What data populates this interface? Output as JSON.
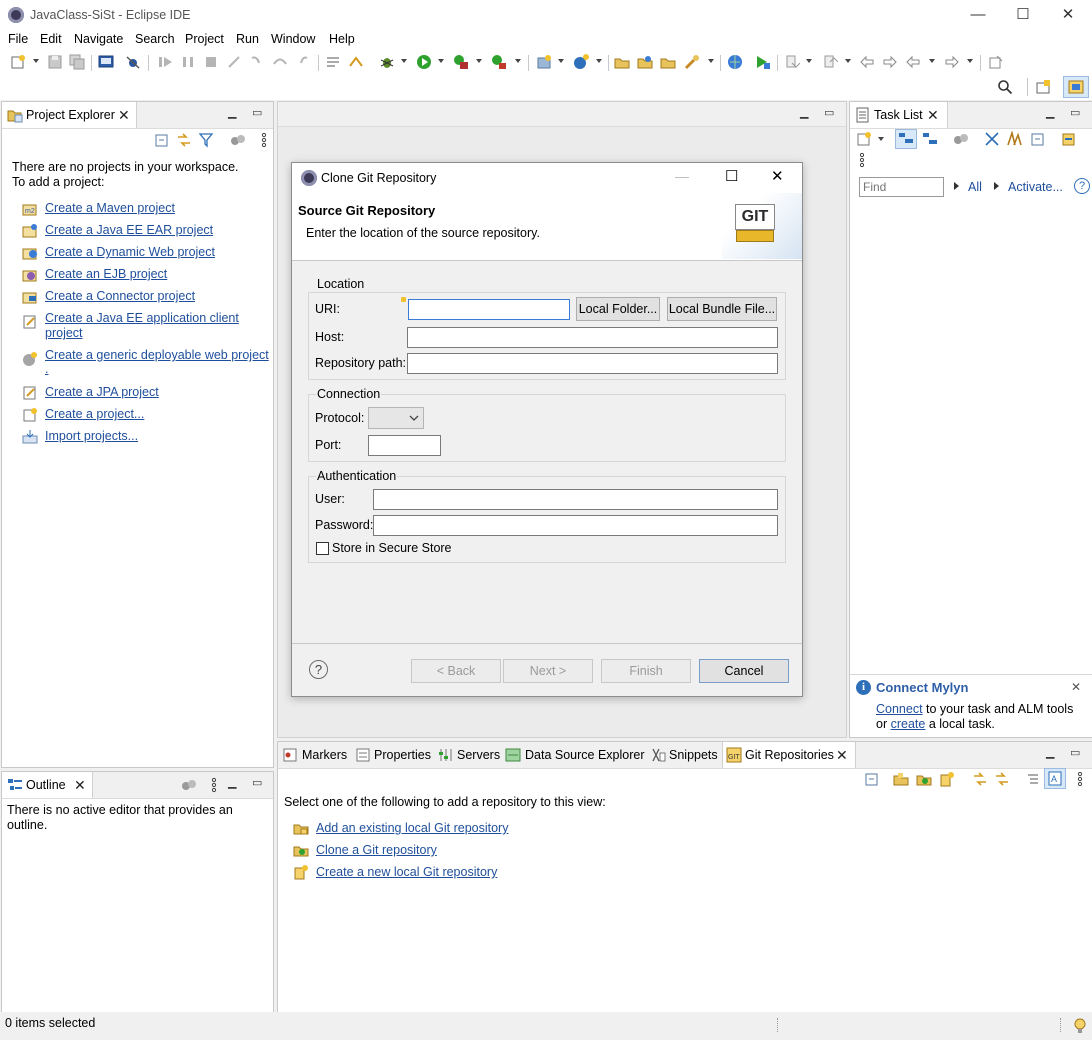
{
  "window": {
    "title": "JavaClass-SiSt - Eclipse IDE"
  },
  "menu": [
    "File",
    "Edit",
    "Navigate",
    "Search",
    "Project",
    "Run",
    "Window",
    "Help"
  ],
  "project_explorer": {
    "tab_label": "Project Explorer",
    "intro_line1": "There are no projects in your workspace.",
    "intro_line2": "To add a project:",
    "links": [
      "Create a Maven project",
      "Create a Java EE EAR project",
      "Create a Dynamic Web project",
      "Create an EJB project",
      "Create a Connector project",
      "Create a Java EE application client ",
      "project",
      "Create a generic deployable web project",
      ".",
      "Create a JPA project",
      "Create a project...",
      "Import projects..."
    ]
  },
  "outline": {
    "tab_label": "Outline",
    "message_line1": "There is no active editor that provides an",
    "message_line2": "outline."
  },
  "task_list": {
    "tab_label": "Task List",
    "find_placeholder": "Find",
    "all_label": "All",
    "activate_label": "Activate...",
    "help_glyph": "?",
    "mylyn_title": "Connect Mylyn",
    "mylyn_connect": "Connect",
    "mylyn_text1": " to your task and ALM tools",
    "mylyn_or": "or ",
    "mylyn_create": "create",
    "mylyn_text2": " a local task."
  },
  "bottom_tabs": [
    "Markers",
    "Properties",
    "Servers",
    "Data Source Explorer",
    "Snippets",
    "Git Repositories"
  ],
  "git_repos": {
    "intro": "Select one of the following to add a repository to this view:",
    "links": [
      "Add an existing local Git repository",
      "Clone a Git repository",
      "Create a new local Git repository"
    ]
  },
  "dialog": {
    "title": "Clone Git Repository",
    "heading": "Source Git Repository",
    "description": "Enter the location of the source repository.",
    "git_badge": "GIT",
    "location": {
      "group_label": "Location",
      "uri_label": "URI:",
      "uri_value": "",
      "local_folder_button": "Local Folder...",
      "local_bundle_button": "Local Bundle File...",
      "host_label": "Host:",
      "host_value": "",
      "repo_path_label": "Repository path:",
      "repo_path_value": ""
    },
    "connection": {
      "group_label": "Connection",
      "protocol_label": "Protocol:",
      "protocol_value": "",
      "port_label": "Port:",
      "port_value": ""
    },
    "authentication": {
      "group_label": "Authentication",
      "user_label": "User:",
      "user_value": "",
      "password_label": "Password:",
      "password_value": "",
      "secure_store_label": "Store in Secure Store",
      "secure_store_checked": false
    },
    "buttons": {
      "back": "< Back",
      "next": "Next >",
      "finish": "Finish",
      "cancel": "Cancel"
    },
    "help_glyph": "?"
  },
  "status": {
    "text": "0 items selected"
  }
}
